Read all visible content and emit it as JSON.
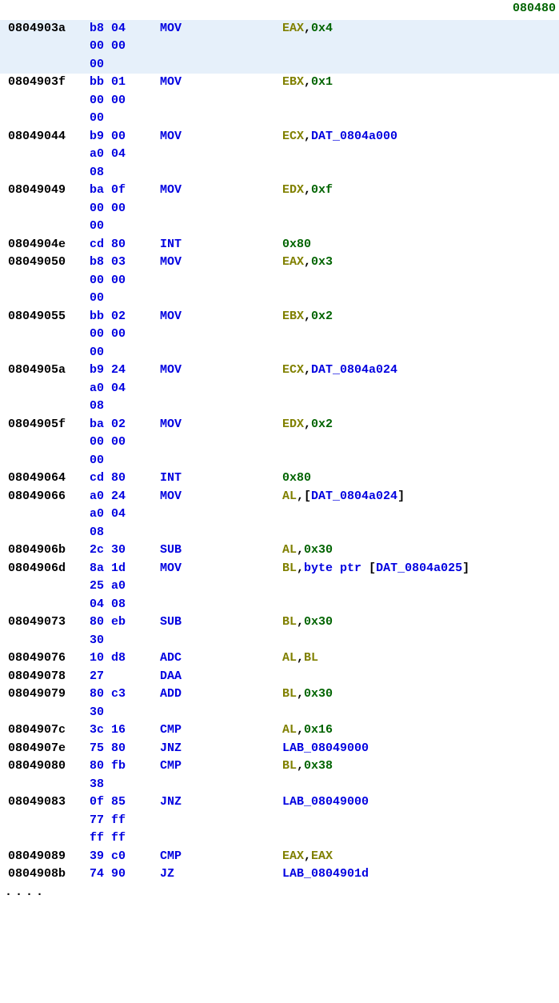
{
  "header_addr": "080480",
  "rows": [
    {
      "addr": "0804903a",
      "bytes": [
        "b8 04",
        "00 00",
        "00"
      ],
      "mnemonic": "MOV",
      "ops": [
        {
          "t": "reg",
          "v": "EAX"
        },
        {
          "t": "punct",
          "v": ","
        },
        {
          "t": "num",
          "v": "0x4"
        }
      ],
      "hl": true
    },
    {
      "addr": "0804903f",
      "bytes": [
        "bb 01",
        "00 00",
        "00"
      ],
      "mnemonic": "MOV",
      "ops": [
        {
          "t": "reg",
          "v": "EBX"
        },
        {
          "t": "punct",
          "v": ","
        },
        {
          "t": "num",
          "v": "0x1"
        }
      ]
    },
    {
      "addr": "08049044",
      "bytes": [
        "b9 00",
        "a0 04",
        "08"
      ],
      "mnemonic": "MOV",
      "ops": [
        {
          "t": "reg",
          "v": "ECX"
        },
        {
          "t": "punct",
          "v": ","
        },
        {
          "t": "sym",
          "v": "DAT_0804a000"
        }
      ]
    },
    {
      "addr": "08049049",
      "bytes": [
        "ba 0f",
        "00 00",
        "00"
      ],
      "mnemonic": "MOV",
      "ops": [
        {
          "t": "reg",
          "v": "EDX"
        },
        {
          "t": "punct",
          "v": ","
        },
        {
          "t": "num",
          "v": "0xf"
        }
      ]
    },
    {
      "addr": "0804904e",
      "bytes": [
        "cd 80"
      ],
      "mnemonic": "INT",
      "ops": [
        {
          "t": "num",
          "v": "0x80"
        }
      ]
    },
    {
      "addr": "08049050",
      "bytes": [
        "b8 03",
        "00 00",
        "00"
      ],
      "mnemonic": "MOV",
      "ops": [
        {
          "t": "reg",
          "v": "EAX"
        },
        {
          "t": "punct",
          "v": ","
        },
        {
          "t": "num",
          "v": "0x3"
        }
      ]
    },
    {
      "addr": "08049055",
      "bytes": [
        "bb 02",
        "00 00",
        "00"
      ],
      "mnemonic": "MOV",
      "ops": [
        {
          "t": "reg",
          "v": "EBX"
        },
        {
          "t": "punct",
          "v": ","
        },
        {
          "t": "num",
          "v": "0x2"
        }
      ]
    },
    {
      "addr": "0804905a",
      "bytes": [
        "b9 24",
        "a0 04",
        "08"
      ],
      "mnemonic": "MOV",
      "ops": [
        {
          "t": "reg",
          "v": "ECX"
        },
        {
          "t": "punct",
          "v": ","
        },
        {
          "t": "sym",
          "v": "DAT_0804a024"
        }
      ]
    },
    {
      "addr": "0804905f",
      "bytes": [
        "ba 02",
        "00 00",
        "00"
      ],
      "mnemonic": "MOV",
      "ops": [
        {
          "t": "reg",
          "v": "EDX"
        },
        {
          "t": "punct",
          "v": ","
        },
        {
          "t": "num",
          "v": "0x2"
        }
      ]
    },
    {
      "addr": "08049064",
      "bytes": [
        "cd 80"
      ],
      "mnemonic": "INT",
      "ops": [
        {
          "t": "num",
          "v": "0x80"
        }
      ]
    },
    {
      "addr": "08049066",
      "bytes": [
        "a0 24",
        "a0 04",
        "08"
      ],
      "mnemonic": "MOV",
      "ops": [
        {
          "t": "reg",
          "v": "AL"
        },
        {
          "t": "punct",
          "v": ",["
        },
        {
          "t": "sym",
          "v": "DAT_0804a024"
        },
        {
          "t": "punct",
          "v": "]"
        }
      ]
    },
    {
      "addr": "0804906b",
      "bytes": [
        "2c 30"
      ],
      "mnemonic": "SUB",
      "ops": [
        {
          "t": "reg",
          "v": "AL"
        },
        {
          "t": "punct",
          "v": ","
        },
        {
          "t": "num",
          "v": "0x30"
        }
      ]
    },
    {
      "addr": "0804906d",
      "bytes": [
        "8a 1d",
        "25 a0",
        "04 08"
      ],
      "mnemonic": "MOV",
      "ops": [
        {
          "t": "reg",
          "v": "BL"
        },
        {
          "t": "punct",
          "v": ","
        },
        {
          "t": "sym",
          "v": "byte ptr "
        },
        {
          "t": "punct",
          "v": "["
        },
        {
          "t": "sym",
          "v": "DAT_0804a025"
        },
        {
          "t": "punct",
          "v": "]"
        }
      ]
    },
    {
      "addr": "08049073",
      "bytes": [
        "80 eb",
        "30"
      ],
      "mnemonic": "SUB",
      "ops": [
        {
          "t": "reg",
          "v": "BL"
        },
        {
          "t": "punct",
          "v": ","
        },
        {
          "t": "num",
          "v": "0x30"
        }
      ]
    },
    {
      "addr": "08049076",
      "bytes": [
        "10 d8"
      ],
      "mnemonic": "ADC",
      "ops": [
        {
          "t": "reg",
          "v": "AL"
        },
        {
          "t": "punct",
          "v": ","
        },
        {
          "t": "reg",
          "v": "BL"
        }
      ]
    },
    {
      "addr": "08049078",
      "bytes": [
        "27"
      ],
      "mnemonic": "DAA",
      "ops": []
    },
    {
      "addr": "08049079",
      "bytes": [
        "80 c3",
        "30"
      ],
      "mnemonic": "ADD",
      "ops": [
        {
          "t": "reg",
          "v": "BL"
        },
        {
          "t": "punct",
          "v": ","
        },
        {
          "t": "num",
          "v": "0x30"
        }
      ]
    },
    {
      "addr": "0804907c",
      "bytes": [
        "3c 16"
      ],
      "mnemonic": "CMP",
      "ops": [
        {
          "t": "reg",
          "v": "AL"
        },
        {
          "t": "punct",
          "v": ","
        },
        {
          "t": "num",
          "v": "0x16"
        }
      ]
    },
    {
      "addr": "0804907e",
      "bytes": [
        "75 80"
      ],
      "mnemonic": "JNZ",
      "ops": [
        {
          "t": "sym",
          "v": "LAB_08049000"
        }
      ]
    },
    {
      "addr": "08049080",
      "bytes": [
        "80 fb",
        "38"
      ],
      "mnemonic": "CMP",
      "ops": [
        {
          "t": "reg",
          "v": "BL"
        },
        {
          "t": "punct",
          "v": ","
        },
        {
          "t": "num",
          "v": "0x38"
        }
      ]
    },
    {
      "addr": "08049083",
      "bytes": [
        "0f 85",
        "77 ff",
        "ff ff"
      ],
      "mnemonic": "JNZ",
      "ops": [
        {
          "t": "sym",
          "v": "LAB_08049000"
        }
      ]
    },
    {
      "addr": "08049089",
      "bytes": [
        "39 c0"
      ],
      "mnemonic": "CMP",
      "ops": [
        {
          "t": "reg",
          "v": "EAX"
        },
        {
          "t": "punct",
          "v": ","
        },
        {
          "t": "reg",
          "v": "EAX"
        }
      ]
    },
    {
      "addr": "0804908b",
      "bytes": [
        "74 90"
      ],
      "mnemonic": "JZ",
      "ops": [
        {
          "t": "sym",
          "v": "LAB_0804901d"
        }
      ]
    }
  ],
  "footer_dots": "...."
}
